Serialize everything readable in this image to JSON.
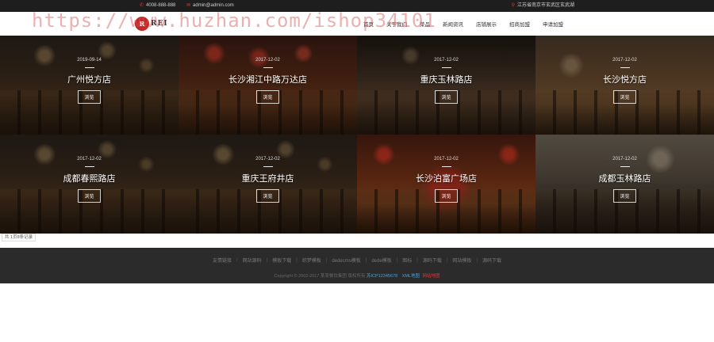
{
  "topbar": {
    "phone": "4008-888-888",
    "email": "admin@admin.com",
    "address": "江苏省南京市玄武区玄武湖"
  },
  "watermark": "https://www.huzhan.com/ishop34101",
  "logo": {
    "mark": "R",
    "text": "REI"
  },
  "nav": [
    "首页",
    "关于我们",
    "菜品",
    "新闻资讯",
    "店铺展示",
    "招商加盟",
    "申请加盟"
  ],
  "stores": [
    {
      "date": "2019-09-14",
      "name": "广州悦方店",
      "button": "浏览"
    },
    {
      "date": "2017-12-02",
      "name": "长沙湘江中路万达店",
      "button": "浏览"
    },
    {
      "date": "2017-12-02",
      "name": "重庆玉林路店",
      "button": "浏览"
    },
    {
      "date": "2017-12-02",
      "name": "长沙悦方店",
      "button": "浏览"
    },
    {
      "date": "2017-12-02",
      "name": "成都春熙路店",
      "button": "浏览"
    },
    {
      "date": "2017-12-02",
      "name": "重庆王府井店",
      "button": "浏览"
    },
    {
      "date": "2017-12-02",
      "name": "长沙泊富广场店",
      "button": "浏览"
    },
    {
      "date": "2017-12-02",
      "name": "成都玉林路店",
      "button": "浏览"
    }
  ],
  "pager": "共 1页8条记录",
  "footer": {
    "links": [
      "友情链接",
      "网站源码",
      "模板下载",
      "织梦模板",
      "dedecms模板",
      "dede模板",
      "图标",
      "源码下载",
      "网站模板",
      "源码下载"
    ],
    "copyright": "Copyright © 2002-2017 某某餐饮集团 版权所有",
    "icp": "苏ICP12345678",
    "xml": "XML地图",
    "sitemap": "网站地图"
  }
}
